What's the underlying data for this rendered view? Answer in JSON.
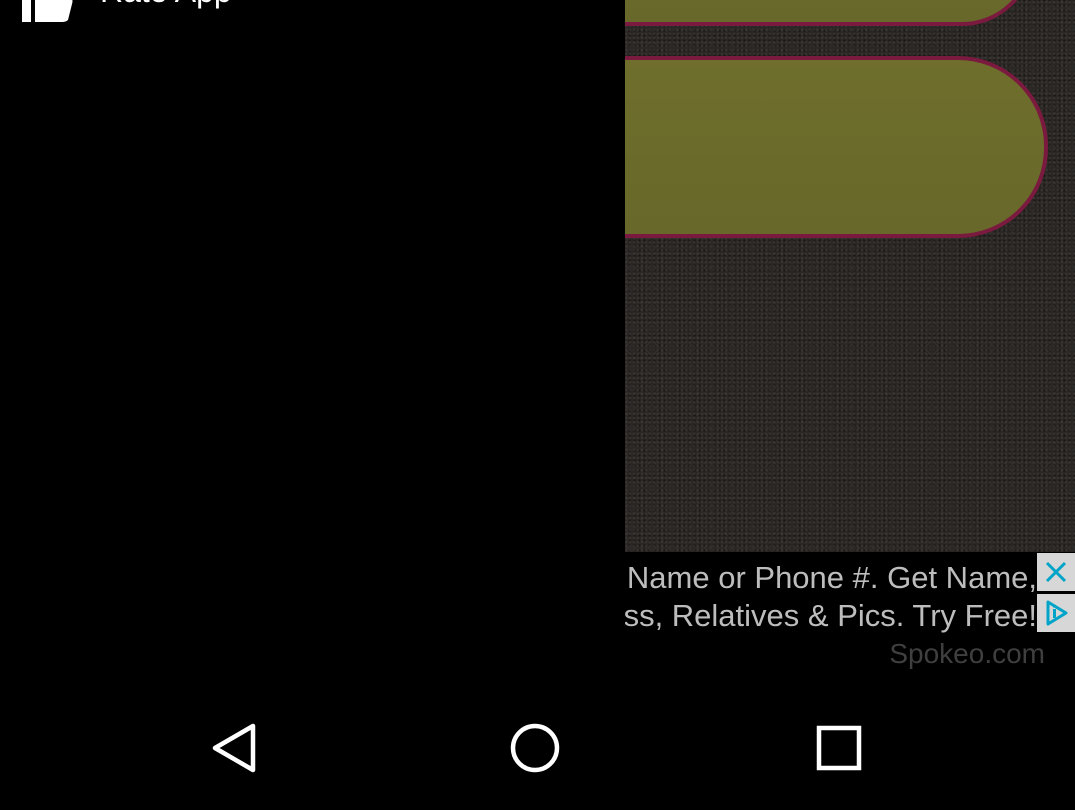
{
  "drawer": {
    "items": [
      {
        "label": "Rate App",
        "icon": "thumbs-up-icon"
      }
    ]
  },
  "ad": {
    "line1": "Search by Name or Phone #. Get Name,",
    "line2": "Address, Relatives & Pics. Try Free!",
    "source": "Spokeo.com",
    "close_icon": "close-icon",
    "info_icon": "ad-choices-icon",
    "accent_color": "#00a4c8"
  },
  "system_nav": {
    "buttons": [
      "back",
      "home",
      "recents"
    ]
  },
  "colors": {
    "pill_fill": "#6b6b2c",
    "pill_border": "#7a1a3e",
    "background": "#2a2624"
  }
}
